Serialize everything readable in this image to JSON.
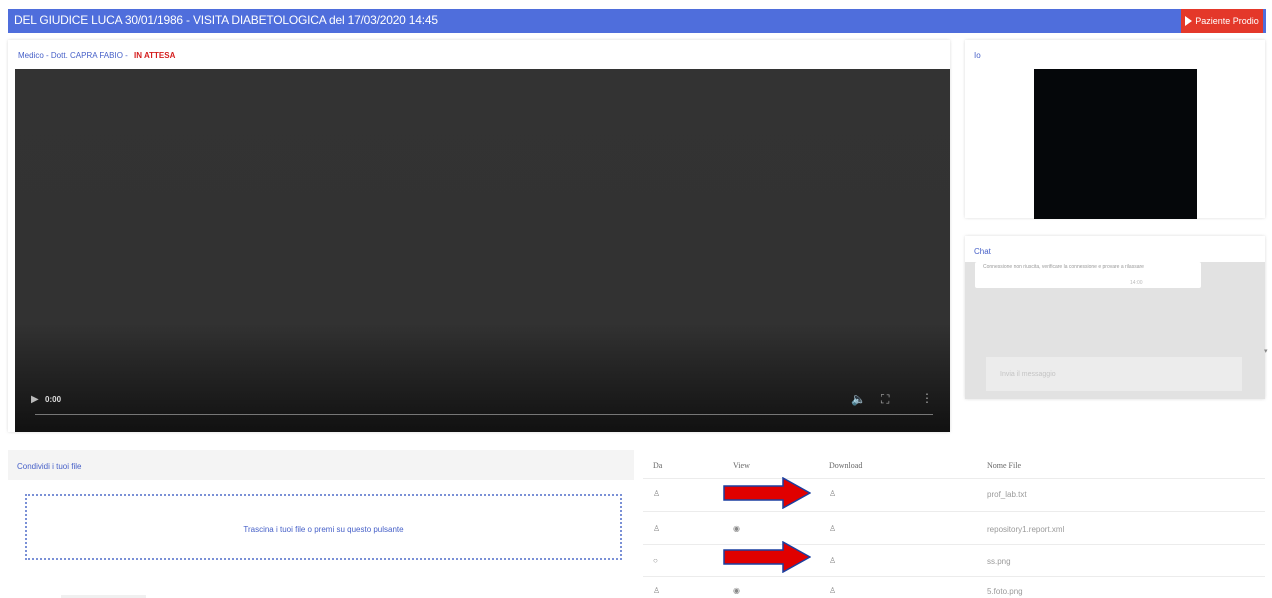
{
  "header": {
    "title": "DEL GIUDICE LUCA 30/01/1986 - VISITA DIABETOLOGICA del 17/03/2020 14:45",
    "end_button_label": "Paziente Prodio"
  },
  "main_video": {
    "doctor_label": "Medico - Dott. CAPRA FABIO -",
    "status": "IN ATTESA",
    "time": "0:00"
  },
  "self_view": {
    "title": "Io"
  },
  "chat": {
    "title": "Chat",
    "messages": [
      {
        "text": "Connessione non riuscita, verificare la connessione e provare a rilassare",
        "time": "14:00"
      }
    ],
    "input_placeholder": "Invia il messaggio"
  },
  "share": {
    "title": "Condividi i tuoi file",
    "drop_text": "Trascina i tuoi file o premi su questo pulsante"
  },
  "files": {
    "headers": [
      "Da",
      "View",
      "Download",
      "Nome File"
    ],
    "rows": [
      {
        "from": "♙",
        "view": "",
        "download": "♙",
        "name": "prof_lab.txt"
      },
      {
        "from": "♙",
        "view": "◉",
        "download": "♙",
        "name": "repository1.report.xml"
      },
      {
        "from": "○",
        "view": "",
        "download": "♙",
        "name": "ss.png"
      },
      {
        "from": "♙",
        "view": "◉",
        "download": "♙",
        "name": "5.foto.png"
      }
    ]
  },
  "colors": {
    "title_bar": "#4f6edc",
    "end_button": "#e4382a",
    "status": "#d41d1d",
    "arrow": "#e00000"
  }
}
